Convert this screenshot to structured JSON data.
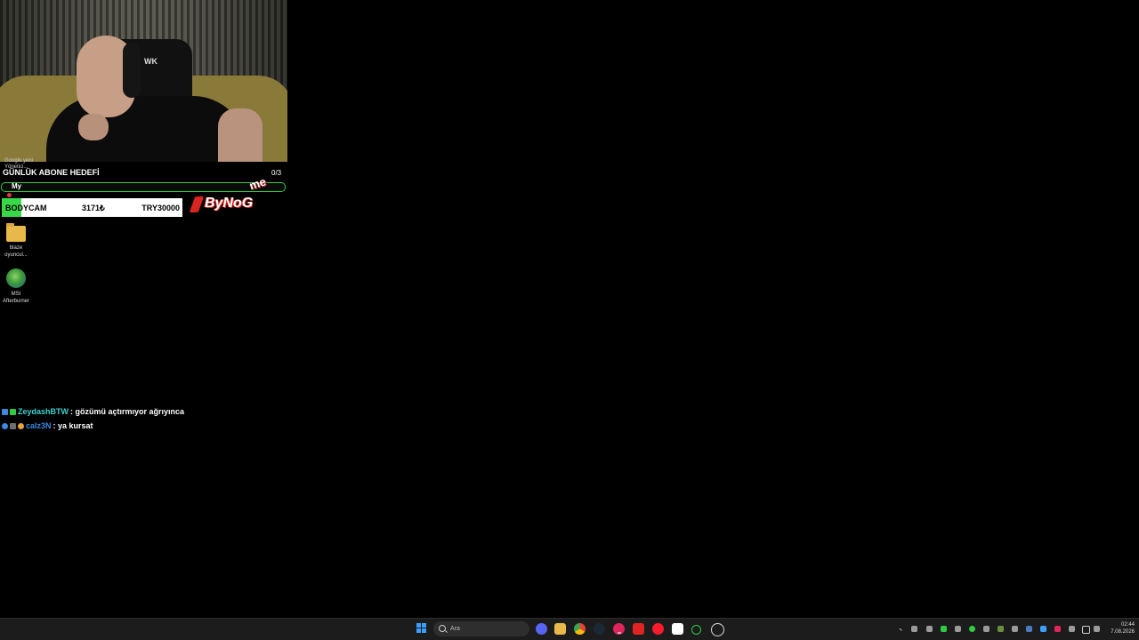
{
  "stream_overlay": {
    "small_labels": [
      "Google yeni",
      "Yönetici..."
    ],
    "goal": {
      "title": "GÜNLÜK ABONE HEDEFİ",
      "count": "0/3",
      "progress": 0.0,
      "name": "My"
    },
    "donation": {
      "label": "BODYCAM",
      "amount": "3171₺",
      "target": "TRY30000",
      "progress": 0.106
    },
    "brand": {
      "text": "ByNoG",
      "accent": "me"
    }
  },
  "desktop_icons": [
    {
      "label_line1": "blaze",
      "label_line2": "oyuncul..."
    },
    {
      "label_line1": "MSI",
      "label_line2": "Afterburner"
    }
  ],
  "chat": [
    {
      "user": "ZeydashBTW",
      "user_color": "#3fd1d1",
      "message": ": gözümü açtırmıyor ağrıyınca"
    },
    {
      "user": "calz3N",
      "user_color": "#3a88e0",
      "message": ": ya kursat"
    }
  ],
  "taskbar": {
    "search_placeholder": "Ara",
    "time": "02:44",
    "date": "7.08.2026"
  },
  "colors": {
    "goal_green": "#2ecc40",
    "donation_green": "#39d84a",
    "brand_red": "#d8251f",
    "taskbar_bg": "#1c1c1c"
  }
}
